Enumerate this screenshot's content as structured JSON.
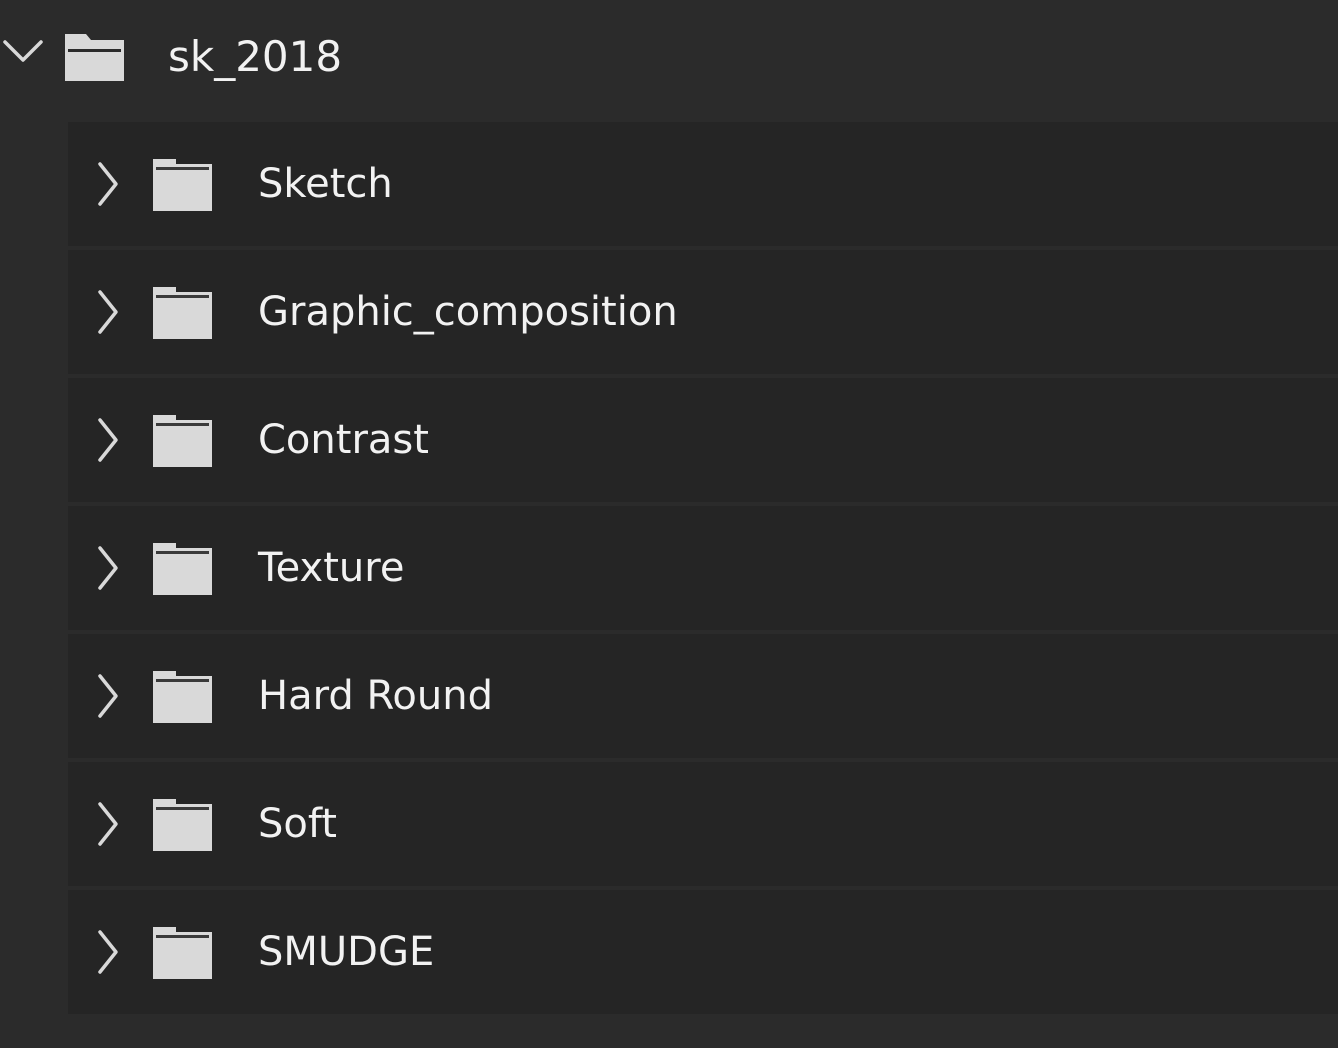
{
  "panel": {
    "background": "#2b2b2b",
    "row_background": "#252525",
    "text_color": "#f2f2f2",
    "icon_color": "#d9d9d9"
  },
  "root": {
    "label": "sk_2018",
    "expanded": true,
    "expander_icon": "chevron-down-icon",
    "folder_icon": "folder-open-icon"
  },
  "children": [
    {
      "label": "Sketch",
      "expanded": false
    },
    {
      "label": "Graphic_composition",
      "expanded": false
    },
    {
      "label": "Contrast",
      "expanded": false
    },
    {
      "label": "Texture",
      "expanded": false
    },
    {
      "label": "Hard Round",
      "expanded": false
    },
    {
      "label": "Soft",
      "expanded": false
    },
    {
      "label": "SMUDGE",
      "expanded": false
    }
  ],
  "child_icons": {
    "expander_icon": "chevron-right-icon",
    "folder_icon": "folder-icon"
  }
}
